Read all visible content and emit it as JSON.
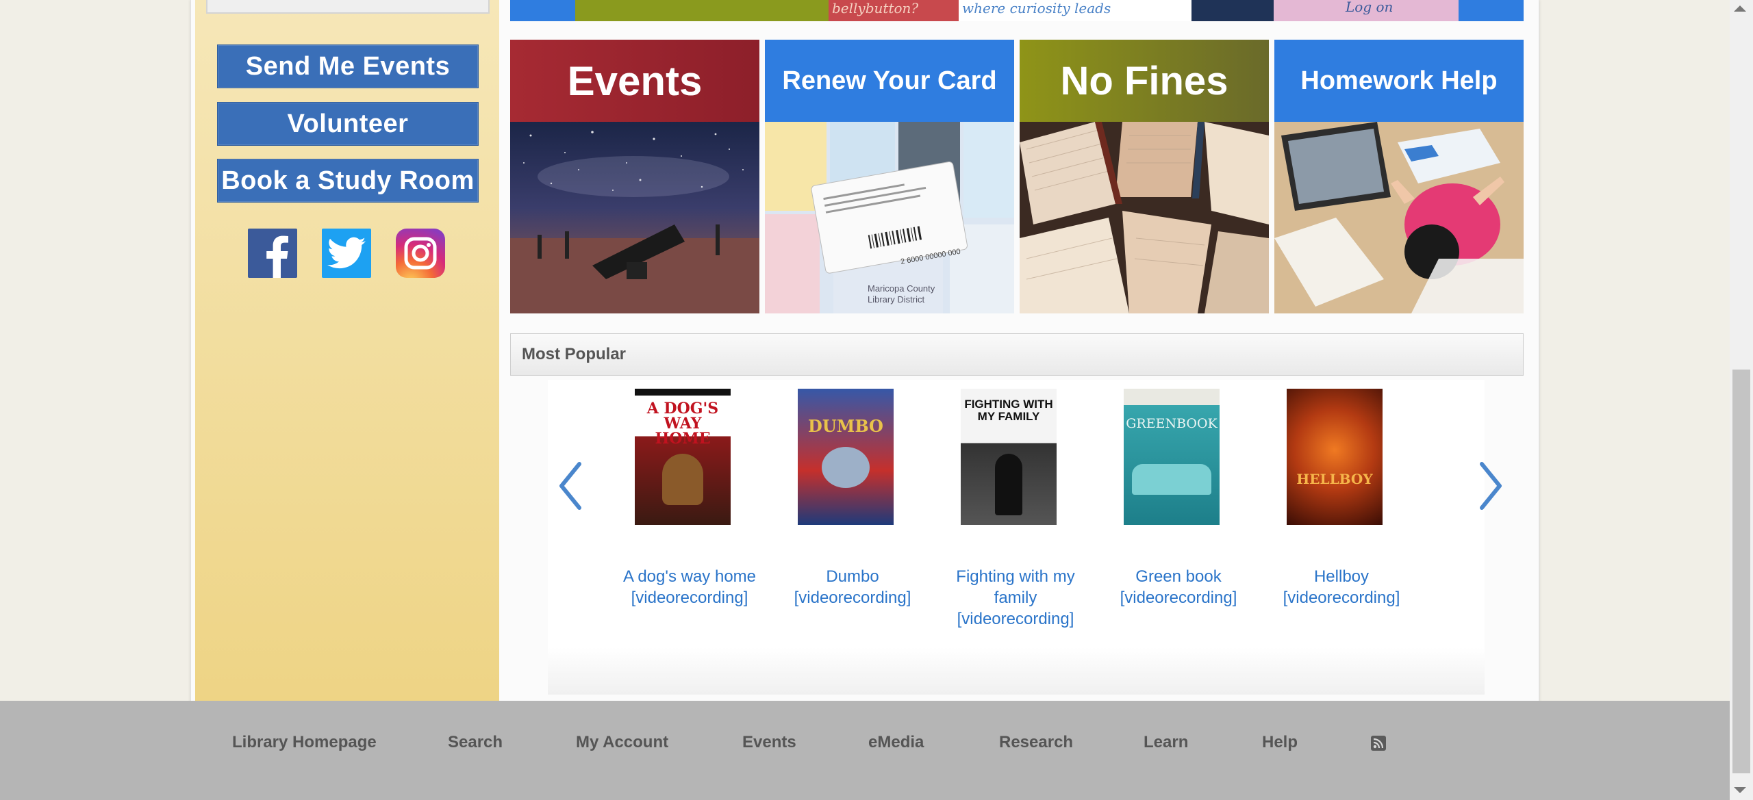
{
  "sidebar": {
    "buttons": [
      "Send Me Events",
      "Volunteer",
      "Book a Study Room"
    ],
    "social": [
      {
        "name": "facebook-icon",
        "color": "#3b5a9a"
      },
      {
        "name": "twitter-icon",
        "color": "#1da1f2"
      },
      {
        "name": "instagram-icon",
        "color": "#d62b7a"
      }
    ]
  },
  "banner": {
    "texts": [
      "bellybutton?",
      "where curiosity leads",
      "Log on"
    ]
  },
  "tiles": [
    {
      "label": "Events",
      "color": "#a0252e"
    },
    {
      "label": "Renew Your Card",
      "color": "#2f7de0"
    },
    {
      "label": "No Fines",
      "color": "#8c8f1c"
    },
    {
      "label": "Homework Help",
      "color": "#2f7de0"
    }
  ],
  "card_text": {
    "barcode_number": "2 6000 00000 000",
    "district_line1": "Maricopa County",
    "district_line2": "Library District"
  },
  "most_popular": {
    "title": "Most Popular",
    "items": [
      {
        "title_line1": "A dog's way home",
        "title_line2": "[videorecording]",
        "cover_text": "A DOG'S WAY HOME",
        "cover_color": "#b01c1c"
      },
      {
        "title_line1": "Dumbo",
        "title_line2": "[videorecording]",
        "cover_text": "DUMBO",
        "cover_color": "#1f3f8a"
      },
      {
        "title_line1": "Fighting with my",
        "title_line2": "family",
        "title_line3": "[videorecording]",
        "cover_text": "FIGHTING WITH MY FAMILY",
        "cover_color": "#e9e9e9"
      },
      {
        "title_line1": "Green book",
        "title_line2": "[videorecording]",
        "cover_text": "GREENBOOK",
        "cover_color": "#2aa0a7"
      },
      {
        "title_line1": "Hellboy",
        "title_line2": "[videorecording]",
        "cover_text": "HELLBOY",
        "cover_color": "#6b1a0c"
      }
    ]
  },
  "footer": {
    "links": [
      "Library Homepage",
      "Search",
      "My Account",
      "Events",
      "eMedia",
      "Research",
      "Learn",
      "Help"
    ]
  }
}
